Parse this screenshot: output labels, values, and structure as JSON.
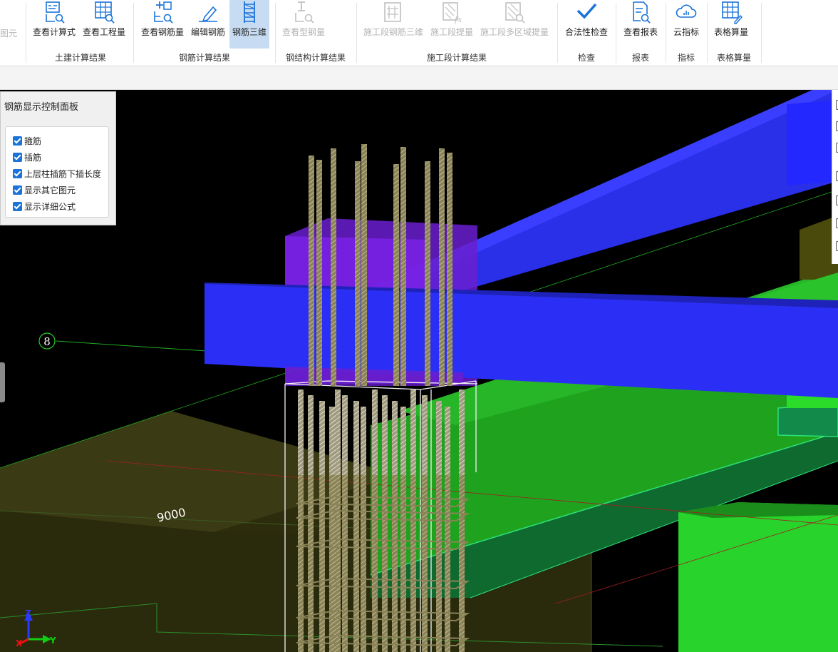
{
  "ribbon": {
    "cutoff_left_label": "图元",
    "buttons": [
      {
        "id": "view-formula",
        "label": "查看计算式",
        "icon": "formula-search-icon",
        "disabled": false,
        "active": false
      },
      {
        "id": "view-quantity",
        "label": "查看工程量",
        "icon": "grid-search-icon",
        "disabled": false,
        "active": false
      },
      {
        "id": "view-rebar-qty",
        "label": "查看钢筋量",
        "icon": "rebar-search-icon",
        "disabled": false,
        "active": false
      },
      {
        "id": "edit-rebar",
        "label": "编辑钢筋",
        "icon": "pencil-icon",
        "disabled": false,
        "active": false
      },
      {
        "id": "rebar-3d",
        "label": "钢筋三维",
        "icon": "rebar-3d-icon",
        "disabled": false,
        "active": true
      },
      {
        "id": "view-steel-qty",
        "label": "查看型钢量",
        "icon": "steel-search-icon",
        "disabled": true,
        "active": false
      },
      {
        "id": "stage-rebar-3d",
        "label": "施工段钢筋三维",
        "icon": "stage-rebar-icon",
        "disabled": true,
        "active": false
      },
      {
        "id": "stage-extract",
        "label": "施工段提量",
        "icon": "stage-fx-icon",
        "disabled": true,
        "active": false
      },
      {
        "id": "stage-multi-extract",
        "label": "施工段多区域提量",
        "icon": "stage-multi-icon",
        "disabled": true,
        "active": false
      },
      {
        "id": "legal-check",
        "label": "合法性检查",
        "icon": "check-icon",
        "disabled": false,
        "active": false
      },
      {
        "id": "view-report",
        "label": "查看报表",
        "icon": "report-search-icon",
        "disabled": false,
        "active": false
      },
      {
        "id": "cloud-index",
        "label": "云指标",
        "icon": "cloud-chart-icon",
        "disabled": false,
        "active": false
      },
      {
        "id": "table-calc",
        "label": "表格算量",
        "icon": "table-edit-icon",
        "disabled": false,
        "active": false
      }
    ],
    "groups": [
      {
        "id": "civil",
        "label": "土建计算结果"
      },
      {
        "id": "rebar",
        "label": "钢筋计算结果"
      },
      {
        "id": "steel",
        "label": "钢结构计算结果"
      },
      {
        "id": "stage",
        "label": "施工段计算结果"
      },
      {
        "id": "check",
        "label": "检查"
      },
      {
        "id": "report",
        "label": "报表"
      },
      {
        "id": "index",
        "label": "指标"
      },
      {
        "id": "table",
        "label": "表格算量"
      }
    ]
  },
  "panel": {
    "title": "钢筋显示控制面板",
    "options": [
      {
        "label": "箍筋",
        "checked": true
      },
      {
        "label": "插筋",
        "checked": true
      },
      {
        "label": "上层柱插筋下插长度",
        "checked": true
      },
      {
        "label": "显示其它图元",
        "checked": true
      },
      {
        "label": "显示详细公式",
        "checked": true
      }
    ]
  },
  "viewport": {
    "axis_grid_label": "8",
    "dimension_label": "9000",
    "axes": {
      "x": "X",
      "y": "Y",
      "z": "Z"
    }
  },
  "colors": {
    "beam_blue": "#2a2ff0",
    "column_purple": "#6a1fd0",
    "slab_green": "#2bd22b",
    "foundation_olive": "#3a3a12",
    "rebar": "#8b8358",
    "accent": "#1a73d9"
  }
}
